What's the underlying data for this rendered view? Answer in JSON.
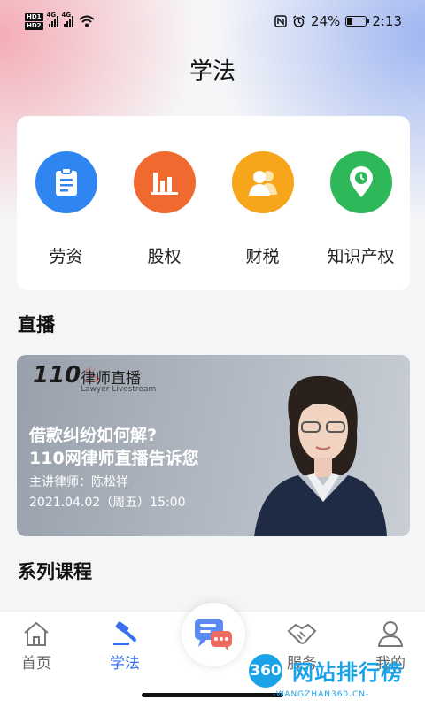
{
  "status_bar": {
    "hd1": "HD1",
    "hd2": "HD2",
    "net1": "4G",
    "net2": "4G",
    "battery": "24%",
    "time": "2:13"
  },
  "header": {
    "title": "学法"
  },
  "categories": [
    {
      "label": "劳资",
      "icon": "clipboard-icon",
      "color": "#2f86f0"
    },
    {
      "label": "股权",
      "icon": "bar-chart-icon",
      "color": "#f06a30"
    },
    {
      "label": "财税",
      "icon": "people-icon",
      "color": "#f7a51b"
    },
    {
      "label": "知识产权",
      "icon": "location-pin-icon",
      "color": "#2fb85a"
    }
  ],
  "live": {
    "section_title": "直播",
    "banner": {
      "logo_number": "110",
      "logo_cn": "律师直播",
      "logo_en": "Lawyer Livestream",
      "headline_1": "借款纠纷如何解?",
      "headline_2": "110网律师直播告诉您",
      "lawyer": "主讲律师：陈松祥",
      "time": "2021.04.02（周五）15:00"
    }
  },
  "series": {
    "section_title": "系列课程"
  },
  "tabbar": {
    "home": "首页",
    "learn": "学法",
    "service": "服务",
    "mine": "我的"
  },
  "watermark": {
    "badge": "360",
    "text": "网站排行榜",
    "sub": "-WANGZHAN360.CN-"
  },
  "colors": {
    "accent": "#3a6ff0",
    "watermark": "#1aa2e8"
  }
}
